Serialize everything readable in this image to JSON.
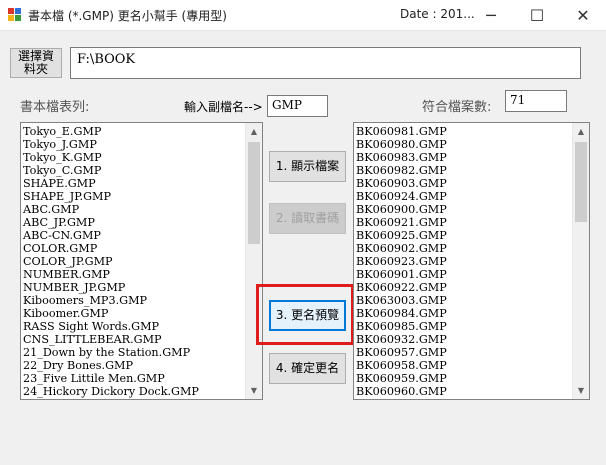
{
  "window": {
    "title": "書本檔 (*.GMP) 更名小幫手 (專用型)",
    "date": "Date : 201...",
    "minimize_glyph": "─",
    "maximize_glyph": "☐",
    "close_glyph": "✕"
  },
  "folder": {
    "button_label": "選擇資\n料夾",
    "path": "F:\\BOOK"
  },
  "left_list": {
    "label": "書本檔表列:",
    "items": [
      "Tokyo_E.GMP",
      "Tokyo_J.GMP",
      "Tokyo_K.GMP",
      "Tokyo_C.GMP",
      "SHAPE.GMP",
      "SHAPE_JP.GMP",
      "ABC.GMP",
      "ABC_JP.GMP",
      "ABC-CN.GMP",
      "COLOR.GMP",
      "COLOR_JP.GMP",
      "NUMBER.GMP",
      "NUMBER_JP.GMP",
      "Kiboomers_MP3.GMP",
      "Kiboomer.GMP",
      "RASS Sight Words.GMP",
      "CNS_LITTLEBEAR.GMP",
      "21_Down by the Station.GMP",
      "22_Dry Bones.GMP",
      "23_Five Littile Men.GMP",
      "24_Hickory Dickory Dock.GMP"
    ]
  },
  "extension": {
    "label": "輸入副檔名-->",
    "value": "GMP"
  },
  "match_count": {
    "label": "符合檔案數:",
    "value": "71"
  },
  "actions": {
    "show_files": "1. 顯示檔案",
    "read_codes": "2. 讀取書碼",
    "preview_rename": "3. 更名預覽",
    "confirm_rename": "4. 確定更名"
  },
  "right_list": {
    "items": [
      "BK060981.GMP",
      "BK060980.GMP",
      "BK060983.GMP",
      "BK060982.GMP",
      "BK060903.GMP",
      "BK060924.GMP",
      "BK060900.GMP",
      "BK060921.GMP",
      "BK060925.GMP",
      "BK060902.GMP",
      "BK060923.GMP",
      "BK060901.GMP",
      "BK060922.GMP",
      "BK063003.GMP",
      "BK060984.GMP",
      "BK060985.GMP",
      "BK060932.GMP",
      "BK060957.GMP",
      "BK060958.GMP",
      "BK060959.GMP",
      "BK060960.GMP"
    ]
  },
  "colors": {
    "highlight": "#e01b1b",
    "focus_border": "#0078d7",
    "window_bg": "#f0f0f0"
  }
}
